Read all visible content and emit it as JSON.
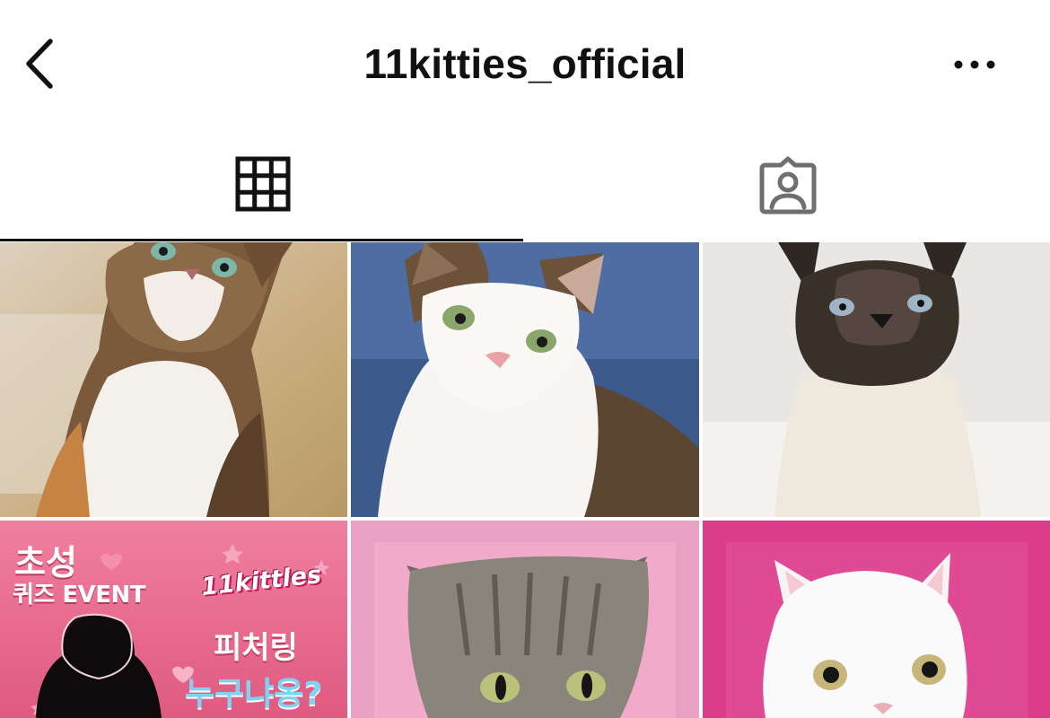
{
  "header": {
    "title": "11kitties_official",
    "back_icon": "chevron-left-icon",
    "more_icon": "more-horizontal-icon"
  },
  "tabs": [
    {
      "name": "posts-grid",
      "icon": "grid-icon",
      "selected": true
    },
    {
      "name": "tagged",
      "icon": "tagged-person-icon",
      "selected": false
    }
  ],
  "posts": [
    {
      "kind": "photo",
      "subject": "calico cat looking up"
    },
    {
      "kind": "photo",
      "subject": "white and tabby cat on blue sofa"
    },
    {
      "kind": "photo",
      "subject": "siamese cat"
    },
    {
      "kind": "event-card",
      "headline": "초성",
      "subline": "퀴즈 EVENT",
      "logo": "11kittles",
      "tagline_1": "피처링",
      "tagline_2": "누구냐옹?"
    },
    {
      "kind": "photo",
      "subject": "grey tabby cat on pink background"
    },
    {
      "kind": "photo",
      "subject": "white cat on magenta background"
    }
  ],
  "colors": {
    "text": "#111111",
    "icon_grey": "#6f6f6f",
    "event_pink": "#e86a86",
    "post5_bg": "#eaa0c2",
    "post6_bg": "#dc3c8c"
  }
}
